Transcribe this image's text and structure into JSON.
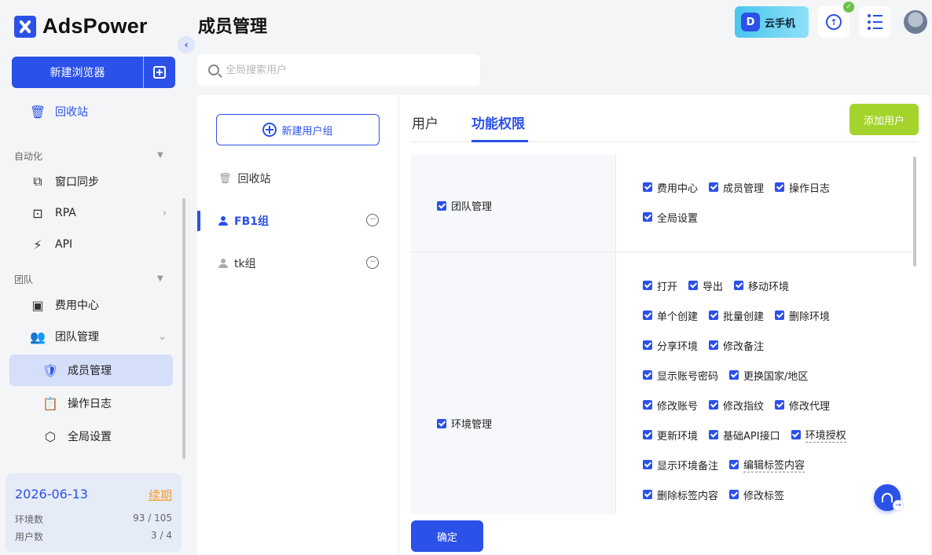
{
  "app": {
    "brand": "AdsPower"
  },
  "sidebar": {
    "new_browser_label": "新建浏览器",
    "recycle_label": "回收站",
    "sections": [
      {
        "label": "自动化"
      },
      {
        "label": "团队"
      }
    ],
    "items": [
      {
        "label": "窗口同步",
        "icon": "window-sync-icon"
      },
      {
        "label": "RPA",
        "icon": "robot-icon"
      },
      {
        "label": "API",
        "icon": "plug-icon"
      },
      {
        "label": "费用中心",
        "icon": "wallet-icon"
      },
      {
        "label": "团队管理",
        "icon": "users-icon"
      },
      {
        "label": "成员管理",
        "icon": "shield-user-icon"
      },
      {
        "label": "操作日志",
        "icon": "clipboard-icon"
      },
      {
        "label": "全局设置",
        "icon": "hexagon-gear-icon"
      }
    ],
    "info": {
      "date": "2026-06-13",
      "renew": "续期",
      "env_label": "环境数",
      "env_value": "93 / 105",
      "user_label": "用户数",
      "user_value": "3 / 4"
    }
  },
  "header": {
    "title": "成员管理",
    "search_placeholder": "全局搜索用户",
    "cloud_phone": "云手机"
  },
  "groups": {
    "new_group_label": "新建用户组",
    "items": [
      {
        "label": "回收站"
      },
      {
        "label": "FB1组"
      },
      {
        "label": "tk组"
      }
    ]
  },
  "main": {
    "tabs": [
      {
        "label": "用户"
      },
      {
        "label": "功能权限"
      }
    ],
    "add_user": "添加用户",
    "confirm": "确定",
    "perm_team": {
      "category": "团队管理",
      "items": [
        "费用中心",
        "成员管理",
        "操作日志",
        "全局设置"
      ]
    },
    "perm_env": {
      "category": "环境管理",
      "items": [
        "打开",
        "导出",
        "移动环境",
        "单个创建",
        "批量创建",
        "删除环境",
        "分享环境",
        "修改备注",
        "显示账号密码",
        "更换国家/地区",
        "修改账号",
        "修改指纹",
        "修改代理",
        "更新环境",
        "基础API接口",
        "环境授权",
        "显示环境备注",
        "编辑标签内容",
        "删除标签内容",
        "修改标签"
      ]
    }
  },
  "colors": {
    "accent": "#2b51e8",
    "add_user": "#a4d42c",
    "renew": "#f0a030"
  }
}
